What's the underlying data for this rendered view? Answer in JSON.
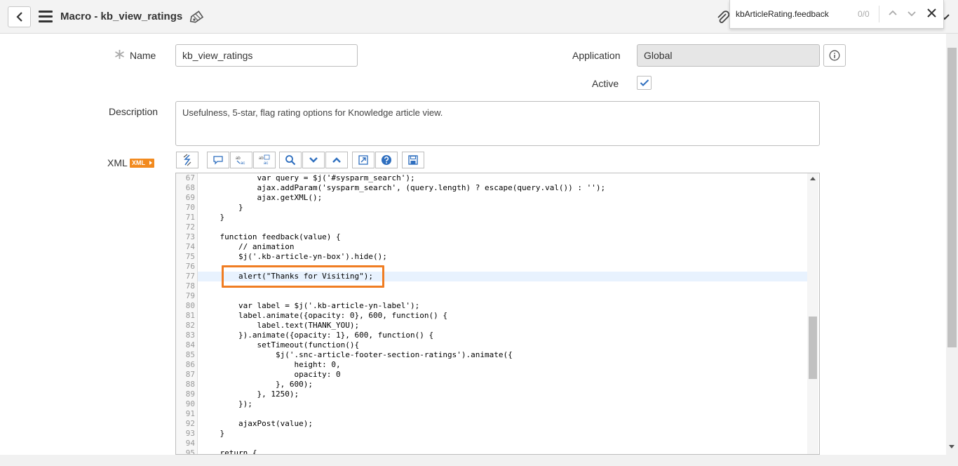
{
  "header": {
    "title": "Macro - kb_view_ratings"
  },
  "findbar": {
    "query": "kbArticleRating.feedback",
    "count": "0/0"
  },
  "form": {
    "name_label": "Name",
    "name_value": "kb_view_ratings",
    "application_label": "Application",
    "application_value": "Global",
    "active_label": "Active",
    "active_checked": true,
    "description_label": "Description",
    "description_value": "Usefulness, 5-star, flag rating options for Knowledge article view.",
    "xml_label": "XML",
    "xml_badge": "XML"
  },
  "toolbar_icons": [
    "format-icon",
    "comment-icon",
    "replace-icon",
    "replace-all-icon",
    "search-icon",
    "chevron-down-icon",
    "chevron-up-icon",
    "fullscreen-icon",
    "help-icon",
    "save-icon"
  ],
  "editor": {
    "highlighted_line": "77",
    "lines": [
      {
        "n": "67",
        "t": "            var query = $j('#sysparm_search');"
      },
      {
        "n": "68",
        "t": "            ajax.addParam('sysparm_search', (query.length) ? escape(query.val()) : '');"
      },
      {
        "n": "69",
        "t": "            ajax.getXML();"
      },
      {
        "n": "70",
        "t": "        }"
      },
      {
        "n": "71",
        "t": "    }"
      },
      {
        "n": "72",
        "t": ""
      },
      {
        "n": "73",
        "t": "    function feedback(value) {"
      },
      {
        "n": "74",
        "t": "        // animation"
      },
      {
        "n": "75",
        "t": "        $j('.kb-article-yn-box').hide();"
      },
      {
        "n": "76",
        "t": ""
      },
      {
        "n": "77",
        "t": "        alert(\"Thanks for Visiting\");"
      },
      {
        "n": "78",
        "t": ""
      },
      {
        "n": "79",
        "t": ""
      },
      {
        "n": "80",
        "t": "        var label = $j('.kb-article-yn-label');"
      },
      {
        "n": "81",
        "t": "        label.animate({opacity: 0}, 600, function() {"
      },
      {
        "n": "82",
        "t": "            label.text(THANK_YOU);"
      },
      {
        "n": "83",
        "t": "        }).animate({opacity: 1}, 600, function() {"
      },
      {
        "n": "84",
        "t": "            setTimeout(function(){"
      },
      {
        "n": "85",
        "t": "                $j('.snc-article-footer-section-ratings').animate({"
      },
      {
        "n": "86",
        "t": "                    height: 0,"
      },
      {
        "n": "87",
        "t": "                    opacity: 0"
      },
      {
        "n": "88",
        "t": "                }, 600);"
      },
      {
        "n": "89",
        "t": "            }, 1250);"
      },
      {
        "n": "90",
        "t": "        });"
      },
      {
        "n": "91",
        "t": ""
      },
      {
        "n": "92",
        "t": "        ajaxPost(value);"
      },
      {
        "n": "93",
        "t": "    }"
      },
      {
        "n": "94",
        "t": ""
      },
      {
        "n": "95",
        "t": "    return {"
      }
    ]
  }
}
